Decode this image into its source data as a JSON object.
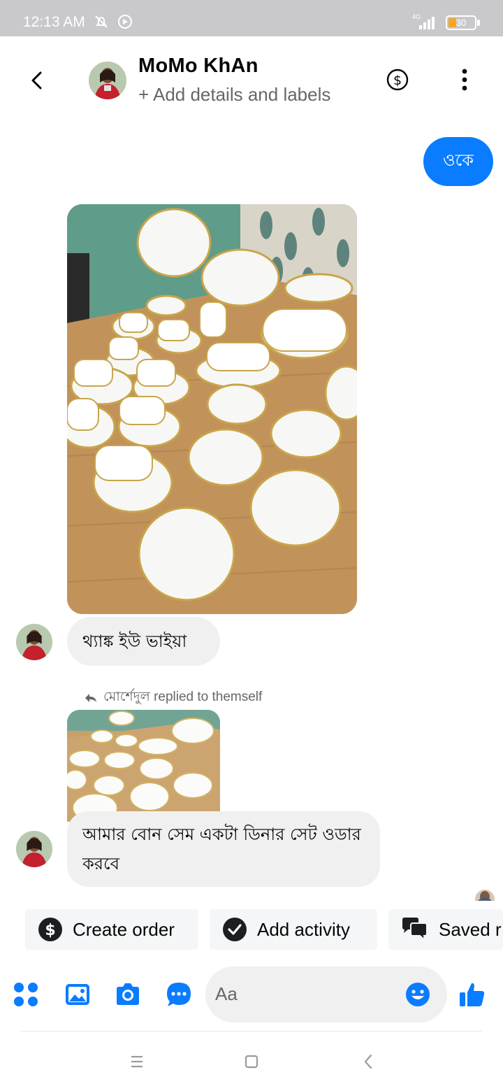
{
  "status_bar": {
    "time": "12:13 AM",
    "network": "4G",
    "battery": "30",
    "battery_level": 0.3
  },
  "header": {
    "contact_name": "MoMo KhAn",
    "subtitle": "+ Add details and labels",
    "icons": [
      "back-arrow-icon",
      "dollar-circle-icon",
      "more-vertical-icon"
    ]
  },
  "messages": [
    {
      "type": "outgoing_text",
      "text": "ওকে"
    },
    {
      "type": "incoming_image",
      "alt": "dinner-set-photo"
    },
    {
      "type": "incoming_text",
      "text": "থ্যাঙ্ক ইউ ভাইয়া"
    },
    {
      "type": "reply_note",
      "text": "মোর্শেদুল replied to themself"
    },
    {
      "type": "incoming_image_reply",
      "alt": "dinner-set-photo-thumbnail"
    },
    {
      "type": "incoming_text",
      "text": "আমার বোন সেম একটা ডিনার সেট ওডার করবে"
    }
  ],
  "quick_actions": [
    {
      "label": "Create order",
      "icon": "dollar-circle-icon"
    },
    {
      "label": "Add activity",
      "icon": "check-circle-icon"
    },
    {
      "label": "Saved r",
      "icon": "chat-bubbles-icon"
    }
  ],
  "composer": {
    "placeholder": "Aa",
    "icons": [
      "apps-icon",
      "gallery-icon",
      "camera-icon",
      "chat-dots-icon",
      "emoji-icon",
      "thumbs-up-icon"
    ]
  },
  "colors": {
    "accent": "#0a7cff",
    "incoming_bubble": "#f0f0f0",
    "status_bar": "#c9c9cc"
  }
}
